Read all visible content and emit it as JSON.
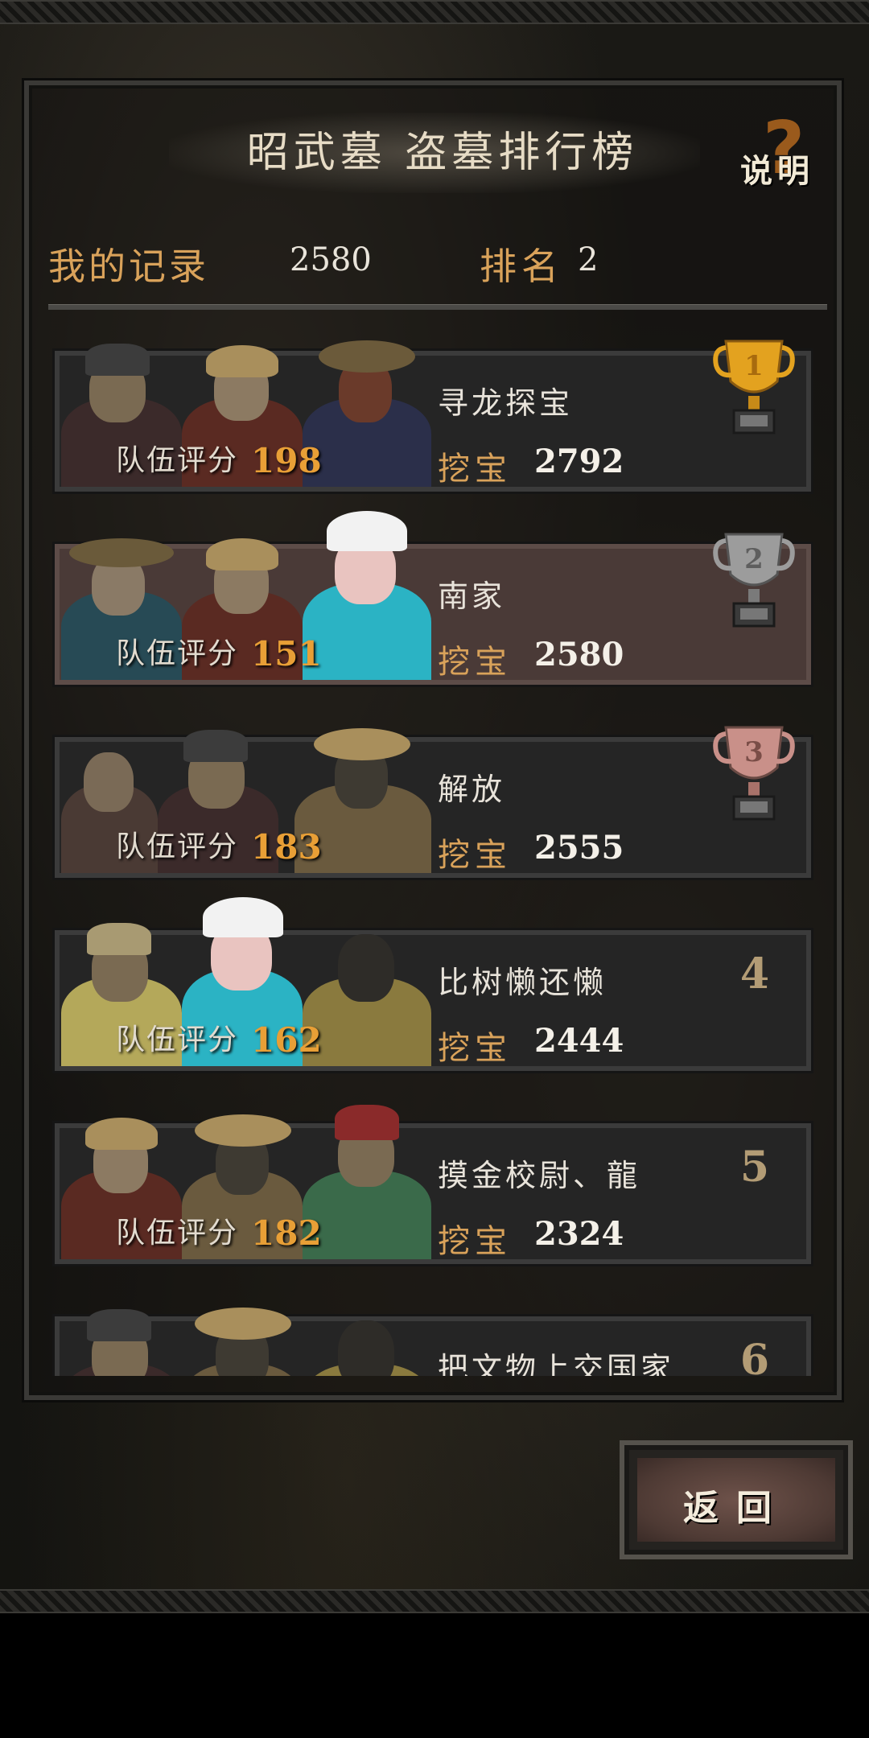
{
  "header": {
    "title": "昭武墓 盗墓排行榜",
    "help_label": "说明",
    "help_glyph": "?"
  },
  "my_record": {
    "label": "我的记录",
    "value": "2580",
    "rank_label": "排名",
    "rank_value": "2"
  },
  "leaderboard": [
    {
      "rank": "1",
      "team_name": "寻龙探宝",
      "score_label": "队伍评分",
      "score": "198",
      "dig_label": "挖宝",
      "dig_value": "2792"
    },
    {
      "rank": "2",
      "team_name": "南家",
      "score_label": "队伍评分",
      "score": "151",
      "dig_label": "挖宝",
      "dig_value": "2580",
      "highlight": true
    },
    {
      "rank": "3",
      "team_name": "解放",
      "score_label": "队伍评分",
      "score": "183",
      "dig_label": "挖宝",
      "dig_value": "2555"
    },
    {
      "rank": "4",
      "team_name": "比树懒还懒",
      "score_label": "队伍评分",
      "score": "162",
      "dig_label": "挖宝",
      "dig_value": "2444"
    },
    {
      "rank": "5",
      "team_name": "摸金校尉、龍",
      "score_label": "队伍评分",
      "score": "182",
      "dig_label": "挖宝",
      "dig_value": "2324"
    },
    {
      "rank": "6",
      "team_name": "把文物上交国家"
    }
  ],
  "back_button": {
    "label": "返回"
  },
  "colors": {
    "gold": "#d9a25a",
    "score": "#e89f36",
    "trophy_gold": "#e3a21f",
    "trophy_silver": "#9c9c9c",
    "trophy_bronze": "#c99089"
  },
  "icons": {
    "trophy_1": "gold-trophy-icon",
    "trophy_2": "silver-trophy-icon",
    "trophy_3": "bronze-trophy-icon"
  }
}
